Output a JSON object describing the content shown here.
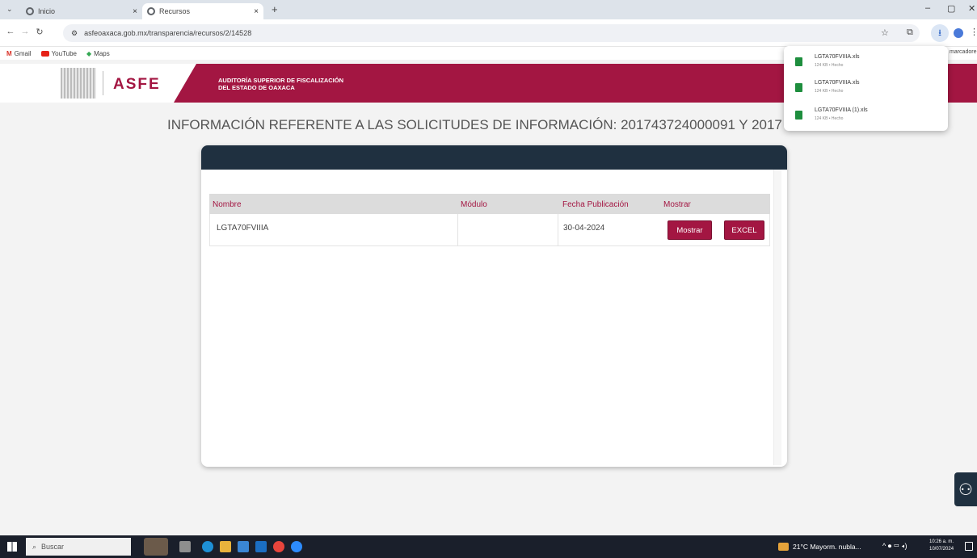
{
  "browser": {
    "tabs": [
      {
        "title": "Inicio",
        "active": false
      },
      {
        "title": "Recursos",
        "active": true
      }
    ],
    "new_tab": "+",
    "tab_close": "×",
    "url": "asfeoaxaca.gob.mx/transparencia/recursos/2/14528",
    "bookmarks": [
      "Gmail",
      "YouTube",
      "Maps"
    ],
    "bookmarks_overflow": "marcadore",
    "window_controls": {
      "minimize": "–",
      "maximize": "▢",
      "close": "✕"
    }
  },
  "site": {
    "logo_text": "ASFE",
    "header_title_line1": "AUDITORÍA SUPERIOR DE FISCALIZACIÓN",
    "header_title_line2": "DEL ESTADO DE OAXACA",
    "brand_color": "#a31642",
    "page_title": "INFORMACIÓN REFERENTE A LAS SOLICITUDES DE INFORMACIÓN: 201743724000091 Y 20174372400"
  },
  "table": {
    "headers": [
      "Nombre",
      "Módulo",
      "Fecha Publicación",
      "Mostrar"
    ],
    "rows": [
      {
        "nombre": "LGTA70FVIIIA",
        "modulo": "",
        "fecha": "30-04-2024",
        "mostrar_label": "Mostrar",
        "excel_label": "EXCEL"
      }
    ]
  },
  "downloads": [
    {
      "name": "LGTA70FVIIIA.xls",
      "status": "124 KB • Hecho"
    },
    {
      "name": "LGTA70FVIIIA.xls",
      "status": "124 KB • Hecho"
    },
    {
      "name": "LGTA70FVIIIA (1).xls",
      "status": "124 KB • Hecho"
    }
  ],
  "taskbar": {
    "search_placeholder": "Buscar",
    "weather": "21°C  Mayorm. nubla...",
    "time": "10:26 a. m.",
    "date": "10/07/2024"
  }
}
